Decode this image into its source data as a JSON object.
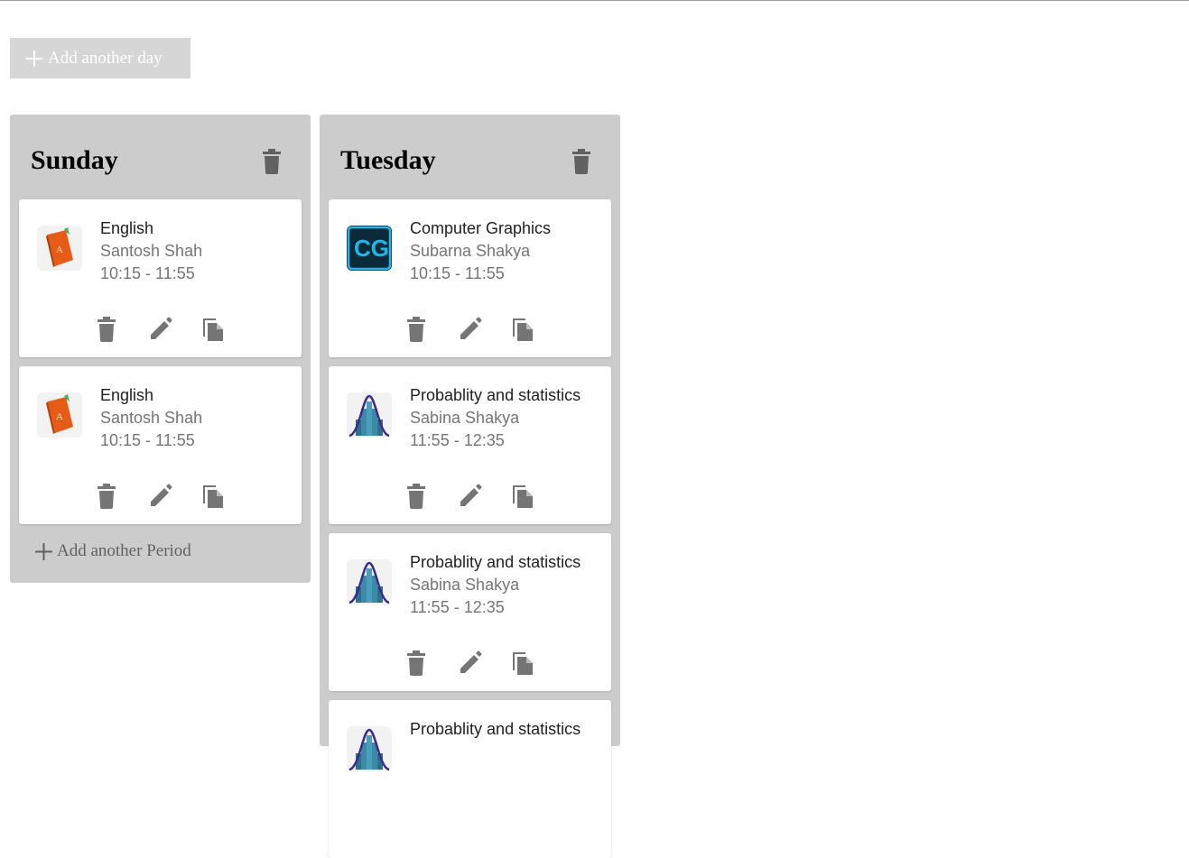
{
  "toolbar": {
    "add_day_label": "Add another day"
  },
  "days": [
    {
      "name": "Sunday",
      "periods": [
        {
          "subject": "English",
          "teacher": "Santosh Shah",
          "time": "10:15 - 11:55",
          "icon": "english-book-icon"
        },
        {
          "subject": "English",
          "teacher": "Santosh Shah",
          "time": "10:15 - 11:55",
          "icon": "english-book-icon"
        }
      ],
      "add_period_label": "Add another Period"
    },
    {
      "name": "Tuesday",
      "periods": [
        {
          "subject": "Computer Graphics",
          "teacher": "Subarna Shakya",
          "time": "10:15 - 11:55",
          "icon": "computer-graphics-icon"
        },
        {
          "subject": "Probablity and statistics",
          "teacher": "Sabina Shakya",
          "time": "11:55 - 12:35",
          "icon": "statistics-icon"
        },
        {
          "subject": "Probablity and statistics",
          "teacher": "Sabina Shakya",
          "time": "11:55 - 12:35",
          "icon": "statistics-icon"
        },
        {
          "subject": "Probablity and statistics"
        }
      ]
    }
  ],
  "colors": {
    "column_bg": "#cccccc",
    "card_bg": "#ffffff",
    "icon_gray": "#616161",
    "add_day_bg": "#d6d6d6"
  }
}
